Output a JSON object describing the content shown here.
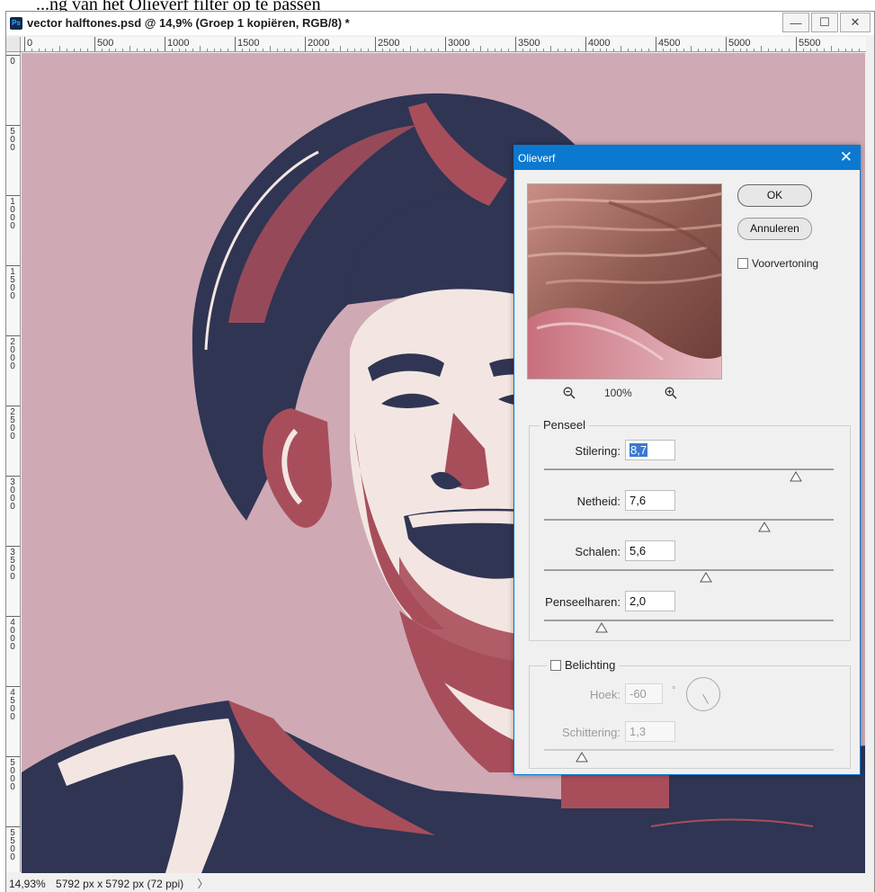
{
  "caption": "...ng van het Olieverf filter op te passen",
  "document": {
    "title": "vector halftones.psd @ 14,9% (Groep 1 kopiëren, RGB/8) *",
    "app_badge": "Ps",
    "window_buttons": {
      "minimize": "—",
      "maximize": "☐",
      "close": "✕"
    },
    "ruler_h_labels": [
      "0",
      "500",
      "1000",
      "1500",
      "2000",
      "2500",
      "3000",
      "3500",
      "4000",
      "4500",
      "5000",
      "5500"
    ],
    "ruler_v_labels": [
      "0",
      "500",
      "1000",
      "1500",
      "2000",
      "2500",
      "3000",
      "3500",
      "4000",
      "4500",
      "5000",
      "5500"
    ],
    "status": {
      "zoom": "14,93%",
      "size": "5792 px x 5792 px (72 ppi)",
      "arrow": "〉"
    }
  },
  "dialog": {
    "title": "Olieverf",
    "close": "✕",
    "ok_label": "OK",
    "cancel_label": "Annuleren",
    "preview_label": "Voorvertoning",
    "preview_checked": false,
    "zoom_out_icon": "zoom-out-icon",
    "zoom_in_icon": "zoom-in-icon",
    "zoom_level": "100%",
    "brush": {
      "group_label": "Penseel",
      "stylization": {
        "label": "Stilering:",
        "value": "8,7",
        "slider": 0.87
      },
      "cleanliness": {
        "label": "Netheid:",
        "value": "7,6",
        "slider": 0.76
      },
      "scale": {
        "label": "Schalen:",
        "value": "5,6",
        "slider": 0.56
      },
      "bristle": {
        "label": "Penseelharen:",
        "value": "2,0",
        "slider": 0.2
      }
    },
    "lighting": {
      "group_label": "Belichting",
      "checked": false,
      "angle": {
        "label": "Hoek:",
        "value": "-60",
        "unit": "°"
      },
      "shine": {
        "label": "Schittering:",
        "value": "1,3",
        "slider": 0.13
      }
    }
  },
  "colors": {
    "background_pink": "#cfaab5",
    "navy": "#2f3553",
    "brick": "#a84e5b",
    "cream": "#f3e6e2",
    "dialog_title": "#0b79d0",
    "selection": "#3b79cf"
  }
}
